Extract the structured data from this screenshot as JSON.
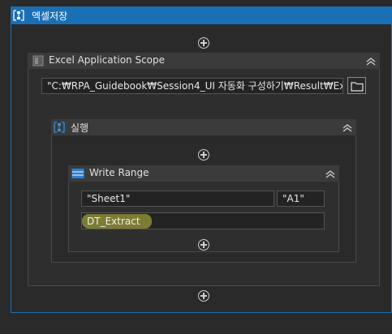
{
  "outer_sequence": {
    "title": "엑셀저장",
    "icon": "sequence-icon"
  },
  "excel_scope": {
    "title": "Excel Application Scope",
    "path_value": "\"C:₩RPA_Guidebook₩Session4_UI 자동화 구성하기₩Result₩Exchan",
    "icon": "excel-scope-icon",
    "browse_icon": "folder-icon"
  },
  "inner_sequence": {
    "title": "실행",
    "icon": "sequence-icon"
  },
  "write_range": {
    "title": "Write Range",
    "sheet_value": "\"Sheet1\"",
    "cell_value": "\"A1\"",
    "datatable_value": "DT_Extract",
    "icon": "write-range-icon"
  },
  "colors": {
    "selected_header": "#1b6fb5",
    "highlight": "#e8e84a",
    "background": "#2a2a2a"
  }
}
